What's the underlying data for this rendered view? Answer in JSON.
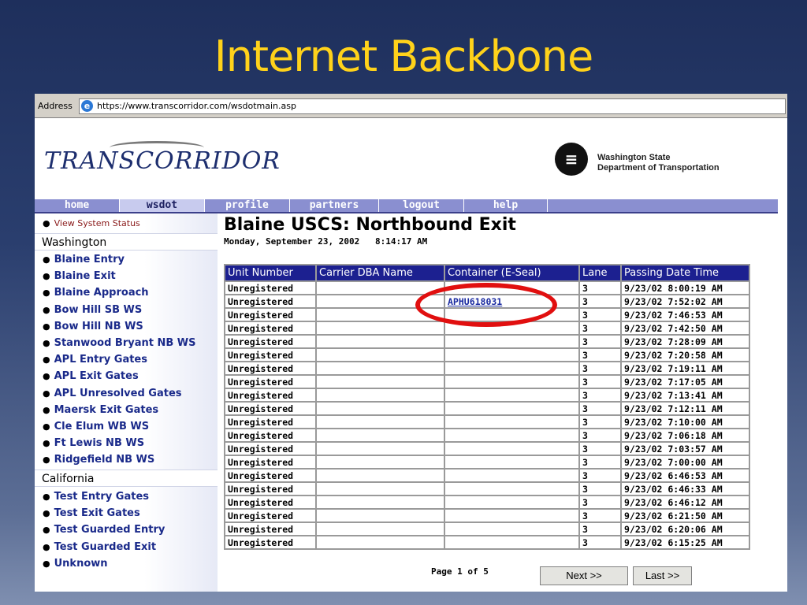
{
  "slide": {
    "title": "Internet Backbone"
  },
  "browser": {
    "address_label": "Address",
    "url": "https://www.transcorridor.com/wsdotmain.asp",
    "ie_icon": "ie-logo-icon"
  },
  "header": {
    "logo_text": "TRANSCORRIDOR",
    "agency_line1": "Washington State",
    "agency_line2": "Department of Transportation"
  },
  "nav": {
    "items": [
      {
        "label": "home"
      },
      {
        "label": "wsdot"
      },
      {
        "label": "profile"
      },
      {
        "label": "partners"
      },
      {
        "label": "logout"
      },
      {
        "label": "help"
      }
    ],
    "active": "wsdot"
  },
  "sidebar": {
    "status_link": "View System Status",
    "washington_heading": "Washington",
    "washington_items": [
      "Blaine Entry",
      "Blaine Exit",
      "Blaine Approach",
      "Bow Hill SB WS",
      "Bow Hill NB WS",
      "Stanwood Bryant NB WS",
      "APL Entry Gates",
      "APL Exit Gates",
      "APL Unresolved Gates",
      "Maersk Exit Gates",
      "Cle Elum WB WS",
      "Ft Lewis NB WS",
      "Ridgefield NB WS"
    ],
    "california_heading": "California",
    "california_items": [
      "Test Entry Gates",
      "Test Exit Gates",
      "Test Guarded Entry",
      "Test Guarded Exit",
      "Unknown"
    ]
  },
  "main": {
    "title": "Blaine USCS: Northbound Exit",
    "date": "Monday, September 23, 2002   8:14:17 AM",
    "columns": [
      "Unit Number",
      "Carrier DBA Name",
      "Container (E-Seal)",
      "Lane",
      "Passing Date Time"
    ],
    "rows": [
      [
        "Unregistered",
        "",
        "",
        "3",
        "9/23/02 8:00:19 AM"
      ],
      [
        "Unregistered",
        "",
        "APHU618031",
        "3",
        "9/23/02 7:52:02 AM"
      ],
      [
        "Unregistered",
        "",
        "",
        "3",
        "9/23/02 7:46:53 AM"
      ],
      [
        "Unregistered",
        "",
        "",
        "3",
        "9/23/02 7:42:50 AM"
      ],
      [
        "Unregistered",
        "",
        "",
        "3",
        "9/23/02 7:28:09 AM"
      ],
      [
        "Unregistered",
        "",
        "",
        "3",
        "9/23/02 7:20:58 AM"
      ],
      [
        "Unregistered",
        "",
        "",
        "3",
        "9/23/02 7:19:11 AM"
      ],
      [
        "Unregistered",
        "",
        "",
        "3",
        "9/23/02 7:17:05 AM"
      ],
      [
        "Unregistered",
        "",
        "",
        "3",
        "9/23/02 7:13:41 AM"
      ],
      [
        "Unregistered",
        "",
        "",
        "3",
        "9/23/02 7:12:11 AM"
      ],
      [
        "Unregistered",
        "",
        "",
        "3",
        "9/23/02 7:10:00 AM"
      ],
      [
        "Unregistered",
        "",
        "",
        "3",
        "9/23/02 7:06:18 AM"
      ],
      [
        "Unregistered",
        "",
        "",
        "3",
        "9/23/02 7:03:57 AM"
      ],
      [
        "Unregistered",
        "",
        "",
        "3",
        "9/23/02 7:00:00 AM"
      ],
      [
        "Unregistered",
        "",
        "",
        "3",
        "9/23/02 6:46:53 AM"
      ],
      [
        "Unregistered",
        "",
        "",
        "3",
        "9/23/02 6:46:33 AM"
      ],
      [
        "Unregistered",
        "",
        "",
        "3",
        "9/23/02 6:46:12 AM"
      ],
      [
        "Unregistered",
        "",
        "",
        "3",
        "9/23/02 6:21:50 AM"
      ],
      [
        "Unregistered",
        "",
        "",
        "3",
        "9/23/02 6:20:06 AM"
      ],
      [
        "Unregistered",
        "",
        "",
        "3",
        "9/23/02 6:15:25 AM"
      ]
    ],
    "pagination": {
      "page_text": "Page 1 of 5",
      "next_label": "Next >>",
      "last_label": "Last >>"
    }
  },
  "colors": {
    "slide_title": "#ffd21a",
    "table_header": "#1c2090",
    "highlight": "#e10f0f",
    "nav_bar": "#8a8fd0"
  }
}
